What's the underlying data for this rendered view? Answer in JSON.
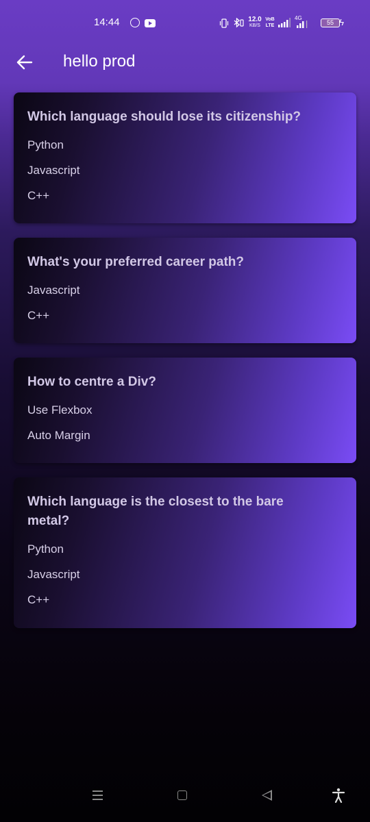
{
  "status_bar": {
    "time": "14:44",
    "net_speed": "12.0",
    "net_unit": "KB/S",
    "volte": "VoB LTE",
    "network_type": "4G",
    "battery": "55",
    "icons": [
      "whatsapp-icon",
      "youtube-icon",
      "vibrate-icon",
      "bluetooth-icon",
      "signal-icon",
      "charging-icon"
    ]
  },
  "app_bar": {
    "title": "hello prod",
    "back_icon": "arrow-left-icon"
  },
  "polls": [
    {
      "question": "Which language should lose its citizenship?",
      "options": [
        "Python",
        "Javascript",
        "C++"
      ]
    },
    {
      "question": "What's your preferred career path?",
      "options": [
        "Javascript",
        "C++"
      ]
    },
    {
      "question": "How to centre a Div?",
      "options": [
        "Use Flexbox",
        "Auto Margin"
      ]
    },
    {
      "question": "Which language is the closest to the bare metal?",
      "options": [
        "Python",
        "Javascript",
        "C++"
      ]
    }
  ],
  "nav_bar": {
    "icons": [
      "recents-icon",
      "home-icon",
      "back-icon",
      "accessibility-icon"
    ]
  },
  "colors": {
    "accent": "#7a4cf5",
    "app_bar": "#6a3cc4",
    "question_text": "#d2c8e6"
  }
}
